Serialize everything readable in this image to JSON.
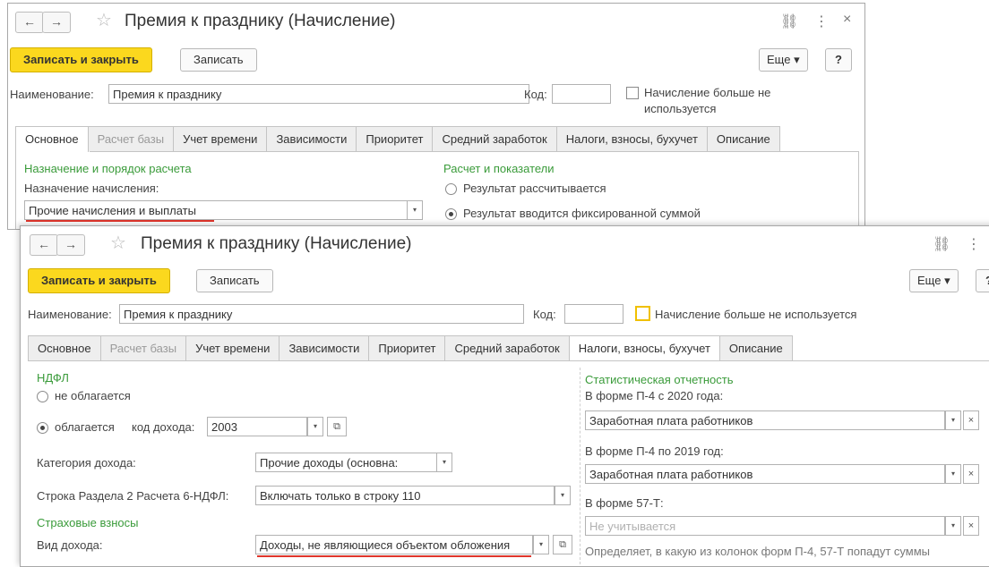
{
  "window1": {
    "title": "Премия к празднику (Начисление)",
    "nav_back": "←",
    "nav_forward": "→",
    "star": "☆",
    "link_icon": "⛓",
    "more_icon": "⋮",
    "close_icon": "×",
    "save_close_label": "Записать и закрыть",
    "save_label": "Записать",
    "more_label": "Еще ▾",
    "help_label": "?",
    "name_label": "Наименование:",
    "name_value": "Премия к празднику",
    "code_label": "Код:",
    "code_value": "",
    "not_used_label_1": "Начисление больше не",
    "not_used_label_2": "используется",
    "tabs": [
      {
        "label": "Основное",
        "state": "active"
      },
      {
        "label": "Расчет базы",
        "state": "disabled"
      },
      {
        "label": "Учет времени",
        "state": "normal"
      },
      {
        "label": "Зависимости",
        "state": "normal"
      },
      {
        "label": "Приоритет",
        "state": "normal"
      },
      {
        "label": "Средний заработок",
        "state": "normal"
      },
      {
        "label": "Налоги, взносы, бухучет",
        "state": "normal"
      },
      {
        "label": "Описание",
        "state": "normal"
      }
    ],
    "section_purpose": "Назначение и порядок расчета",
    "purpose_label": "Назначение начисления:",
    "purpose_value": "Прочие начисления и выплаты",
    "section_calc": "Расчет и показатели",
    "radio_calculated": "Результат рассчитывается",
    "radio_fixed": "Результат вводится фиксированной суммой"
  },
  "window2": {
    "title": "Премия к празднику (Начисление)",
    "nav_back": "←",
    "nav_forward": "→",
    "star": "☆",
    "link_icon": "⛓",
    "more_icon": "⋮",
    "save_close_label": "Записать и закрыть",
    "save_label": "Записать",
    "more_label": "Еще ▾",
    "help_label": "?",
    "name_label": "Наименование:",
    "name_value": "Премия к празднику",
    "code_label": "Код:",
    "code_value": "",
    "not_used_label": "Начисление больше не используется",
    "tabs": [
      {
        "label": "Основное",
        "state": "normal"
      },
      {
        "label": "Расчет базы",
        "state": "disabled"
      },
      {
        "label": "Учет времени",
        "state": "normal"
      },
      {
        "label": "Зависимости",
        "state": "normal"
      },
      {
        "label": "Приоритет",
        "state": "normal"
      },
      {
        "label": "Средний заработок",
        "state": "normal"
      },
      {
        "label": "Налоги, взносы, бухучет",
        "state": "active"
      },
      {
        "label": "Описание",
        "state": "normal"
      }
    ],
    "ndfl_title": "НДФЛ",
    "radio_not_taxed": "не облагается",
    "radio_taxed": "облагается",
    "income_code_label": "код дохода:",
    "income_code_value": "2003",
    "income_category_label": "Категория дохода:",
    "income_category_value": "Прочие доходы (основна:",
    "line_6ndfl_label": "Строка Раздела 2 Расчета 6-НДФЛ:",
    "line_6ndfl_value": "Включать только в строку 110",
    "insurance_title": "Страховые взносы",
    "income_type_label": "Вид дохода:",
    "income_type_value": "Доходы, не являющиеся объектом обложения",
    "stat_title": "Статистическая отчетность",
    "p4_2020_label": "В форме П-4 с 2020 года:",
    "p4_2020_value": "Заработная плата работников",
    "p4_2019_label": "В форме П-4 по 2019 год:",
    "p4_2019_value": "Заработная плата работников",
    "t57_label": "В форме 57-Т:",
    "t57_placeholder": "Не учитывается",
    "stat_note": "Определяет, в какую из колонок форм П-4, 57-Т попадут суммы"
  },
  "colors": {
    "accent_green": "#3a9b3a",
    "primary_button": "#fbd81e",
    "underline_red": "#e0352b"
  }
}
